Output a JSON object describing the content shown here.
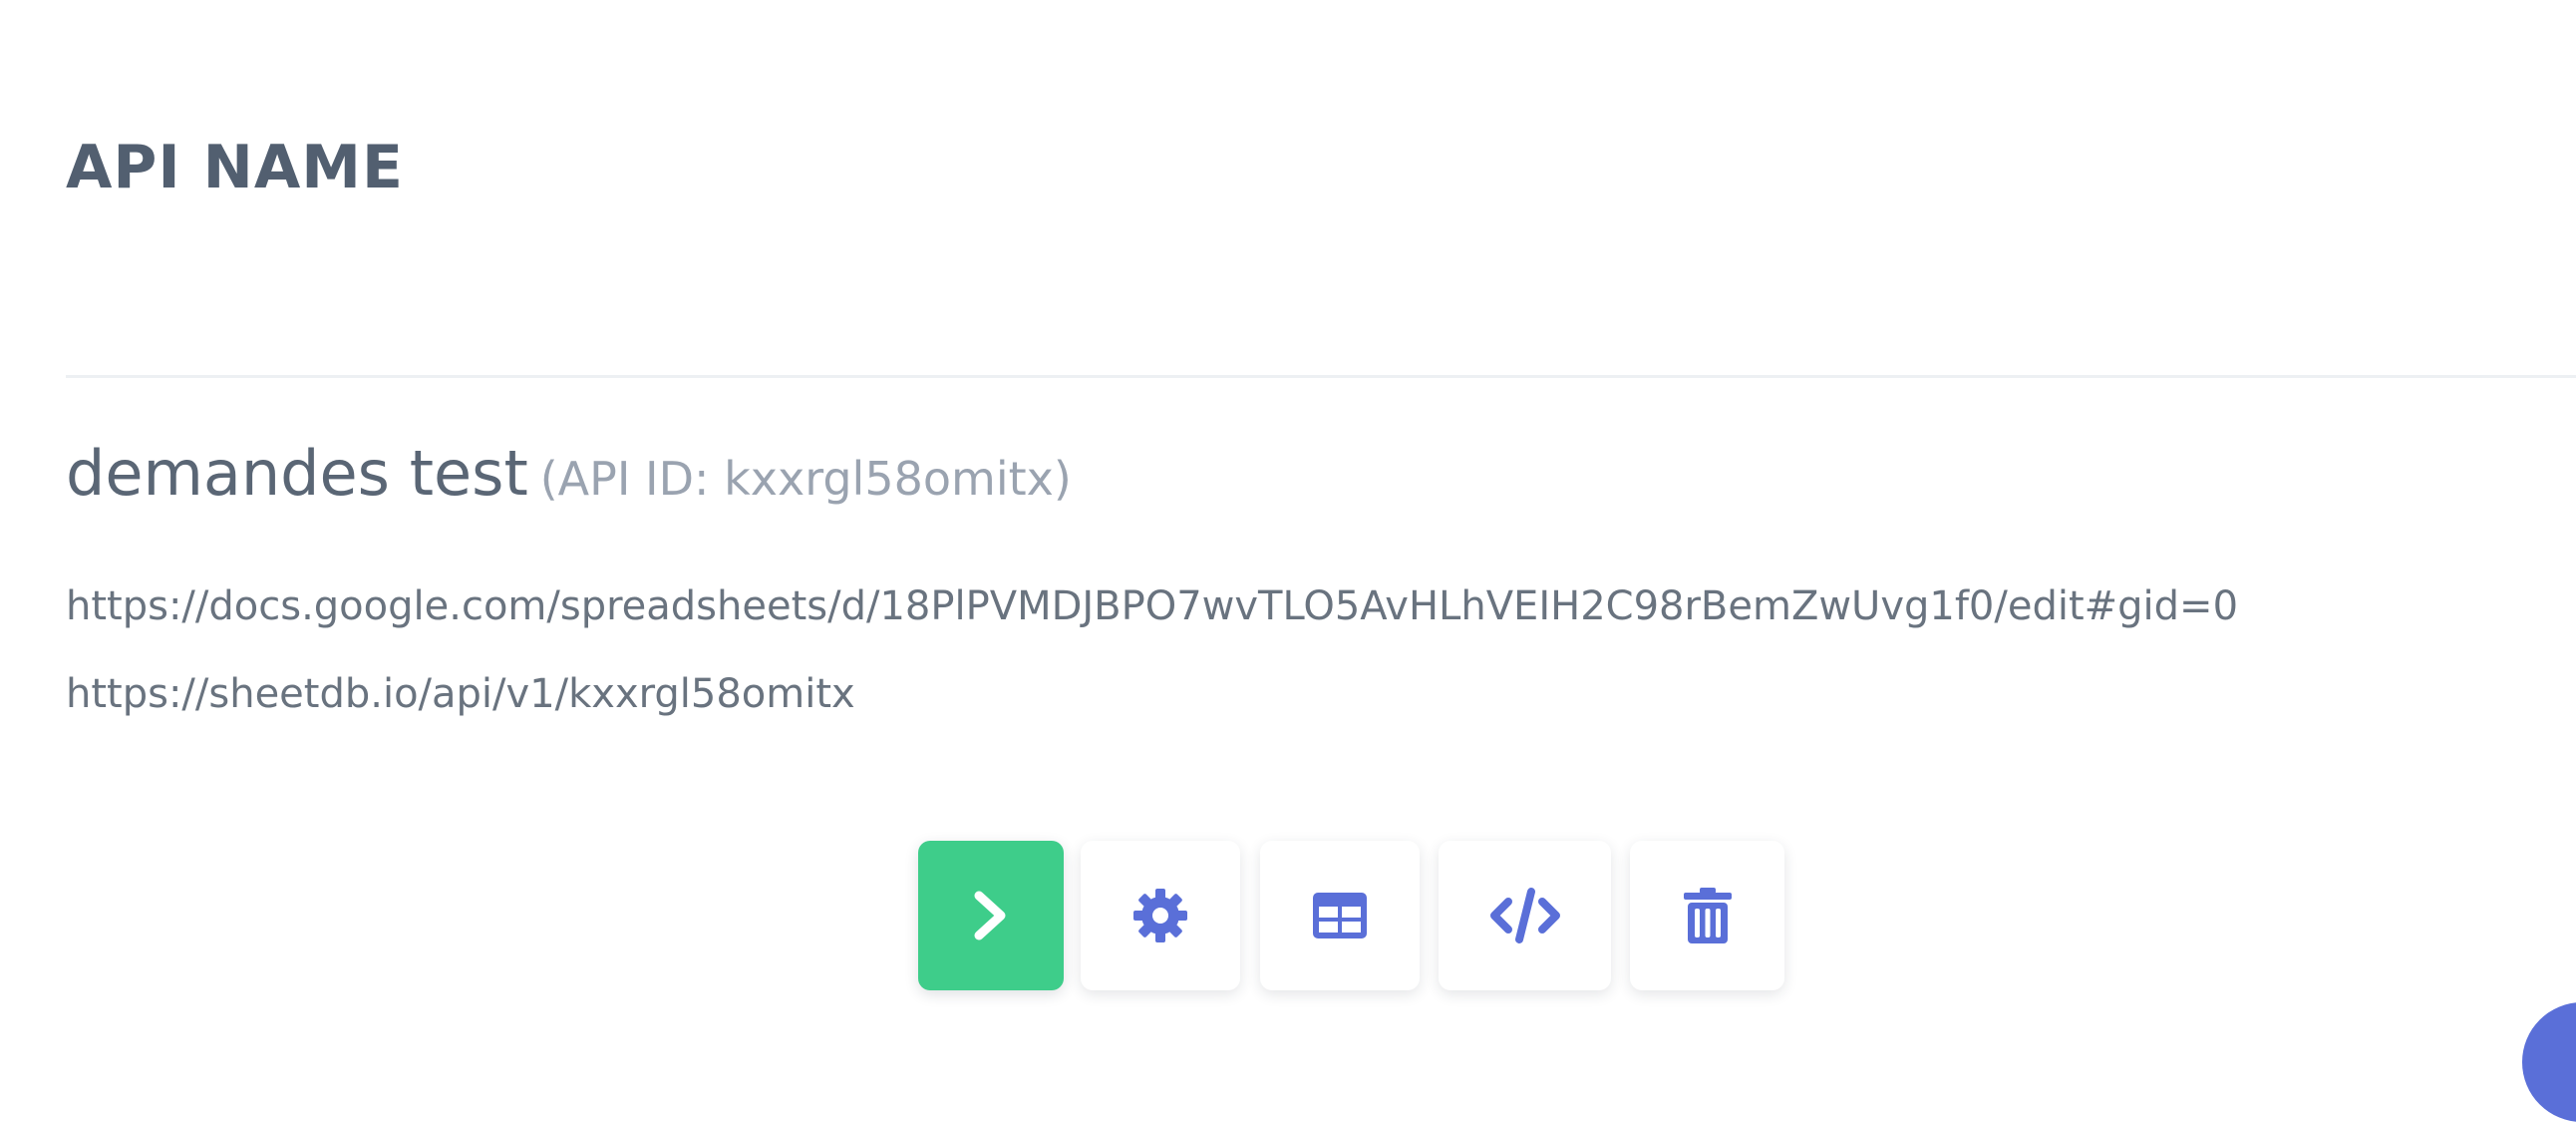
{
  "section": {
    "title": "API NAME"
  },
  "api": {
    "name": "demandes test",
    "id_label": "(API ID: kxxrgl58omitx)",
    "spreadsheet_url": "https://docs.google.com/spreadsheets/d/18PlPVMDJBPO7wvTLO5AvHLhVEIH2C98rBemZwUvg1f0/edit#gid=0",
    "api_url": "https://sheetdb.io/api/v1/kxxrgl58omitx"
  },
  "actions": [
    {
      "name": "run",
      "icon": "chevron-right-icon"
    },
    {
      "name": "settings",
      "icon": "gear-icon"
    },
    {
      "name": "table",
      "icon": "table-icon"
    },
    {
      "name": "code",
      "icon": "code-icon"
    },
    {
      "name": "delete",
      "icon": "trash-icon"
    }
  ],
  "colors": {
    "run_button": "#3ecd8a",
    "icon_accent": "#5a6fd8",
    "heading": "#525f70",
    "muted": "#9aa3b0"
  }
}
